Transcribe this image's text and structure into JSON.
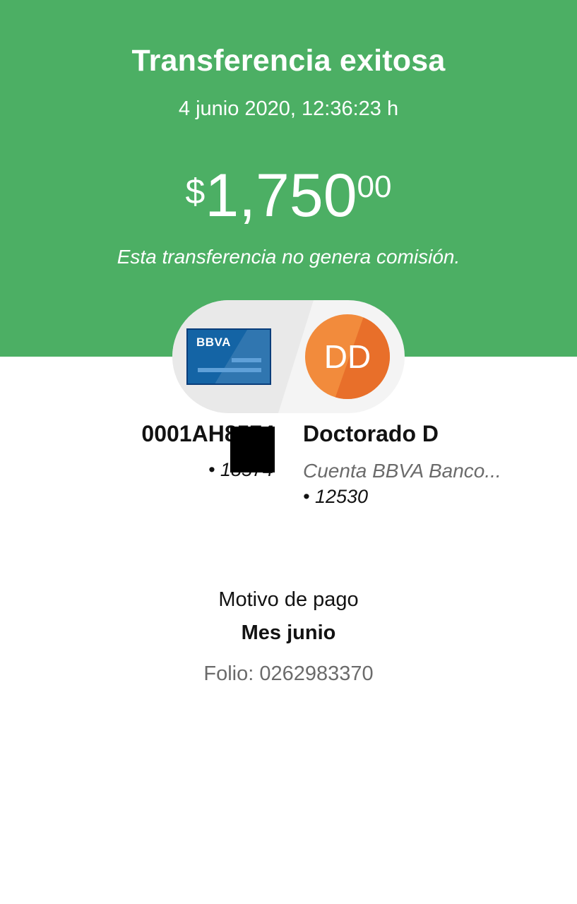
{
  "header": {
    "title": "Transferencia exitosa",
    "datetime": "4 junio 2020, 12:36:23 h",
    "amount": {
      "currency": "$",
      "integer": "1,750",
      "decimals": "00"
    },
    "commission_note": "Esta transferencia no genera comisión."
  },
  "transfer": {
    "source": {
      "card_brand": "BBVA",
      "card_icon": "bank-card-icon",
      "account": "0001AH8574",
      "suffix": "• 18574"
    },
    "destination": {
      "initials": "DD",
      "name": "Doctorado D",
      "bank": "Cuenta BBVA Banco...",
      "suffix": "• 12530"
    }
  },
  "details": {
    "motive_label": "Motivo de pago",
    "motive_value": "Mes junio",
    "folio": "Folio: 0262983370"
  },
  "colors": {
    "header_green": "#4caf64",
    "card_blue": "#1464a5",
    "avatar_orange": "#f28b3c"
  }
}
